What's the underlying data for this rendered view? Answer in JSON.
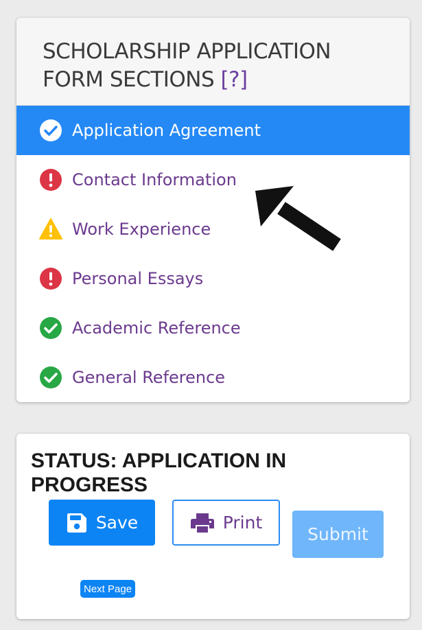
{
  "sections": {
    "title": "SCHOLARSHIP APPLICATION FORM SECTIONS",
    "help_label": "[?]",
    "items": [
      {
        "label": "Application Agreement",
        "status_icon": "check-circle-icon",
        "active": true
      },
      {
        "label": "Contact Information",
        "status_icon": "error-circle-icon",
        "active": false
      },
      {
        "label": "Work Experience",
        "status_icon": "warning-triangle-icon",
        "active": false
      },
      {
        "label": "Personal Essays",
        "status_icon": "error-circle-icon",
        "active": false
      },
      {
        "label": "Academic Reference",
        "status_icon": "check-circle-icon",
        "active": false
      },
      {
        "label": "General Reference",
        "status_icon": "check-circle-icon",
        "active": false
      }
    ]
  },
  "status": {
    "title": "STATUS: APPLICATION IN PROGRESS",
    "save_label": "Save",
    "print_label": "Print",
    "submit_label": "Submit",
    "next_page_label": "Next Page"
  },
  "colors": {
    "accent": "#2589f5",
    "item_text": "#6b3a8e",
    "error": "#dc3545",
    "warning": "#ffc107",
    "success": "#28a745"
  }
}
